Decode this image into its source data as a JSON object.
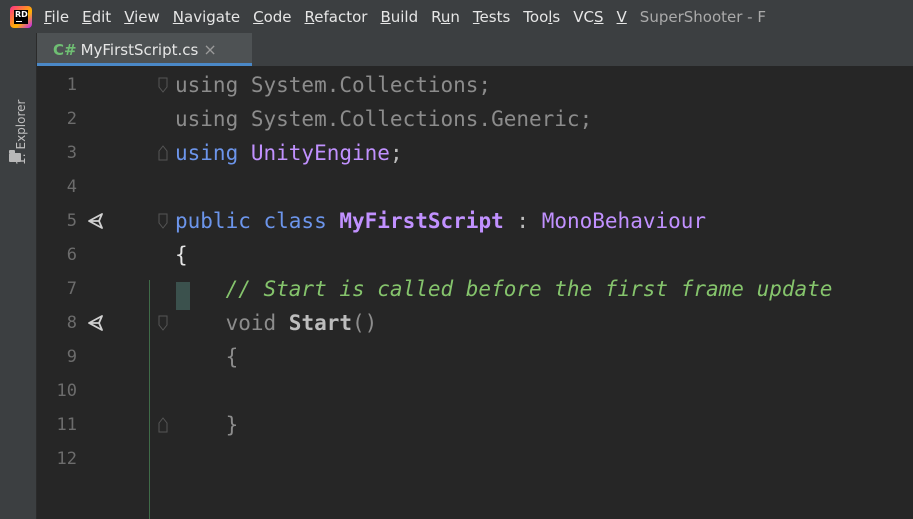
{
  "menubar": {
    "items": [
      {
        "label": "File",
        "mnemonic": "F",
        "rest": "ile"
      },
      {
        "label": "Edit",
        "mnemonic": "E",
        "rest": "dit"
      },
      {
        "label": "View",
        "mnemonic": "V",
        "rest": "iew"
      },
      {
        "label": "Navigate",
        "mnemonic": "N",
        "rest": "avigate"
      },
      {
        "label": "Code",
        "mnemonic": "C",
        "rest": "ode"
      },
      {
        "label": "Refactor",
        "mnemonic": "R",
        "rest": "efactor"
      },
      {
        "label": "Build",
        "mnemonic": "B",
        "rest": "uild"
      },
      {
        "label": "Run",
        "pre": "R",
        "mnemonic": "u",
        "rest": "n"
      },
      {
        "label": "Tests",
        "mnemonic": "T",
        "rest": "ests"
      },
      {
        "label": "Tools",
        "pre": "Too",
        "mnemonic": "l",
        "rest": "s"
      },
      {
        "label": "VCS",
        "pre": "VC",
        "mnemonic": "S",
        "rest": ""
      },
      {
        "label": "V",
        "mnemonic": "V",
        "rest": ""
      }
    ],
    "window_title": "SuperShooter - F"
  },
  "sidebar": {
    "explorer_label": "1: Explorer"
  },
  "tabs": [
    {
      "lang": "C#",
      "filename": "MyFirstScript.cs",
      "close": "×"
    }
  ],
  "editor": {
    "lines": [
      {
        "n": "1",
        "tokens": [
          [
            "dim",
            "using System.Collections;"
          ]
        ]
      },
      {
        "n": "2",
        "tokens": [
          [
            "dim",
            "using System.Collections.Generic;"
          ]
        ]
      },
      {
        "n": "3",
        "tokens": [
          [
            "kw",
            "using "
          ],
          [
            "ns",
            "UnityEngine"
          ],
          [
            "plain",
            ";"
          ]
        ]
      },
      {
        "n": "4",
        "tokens": []
      },
      {
        "n": "5",
        "tokens": [
          [
            "kw",
            "public class "
          ],
          [
            "classname",
            "MyFirstScript"
          ],
          [
            "plain",
            " : "
          ],
          [
            "type",
            "MonoBehaviour"
          ]
        ]
      },
      {
        "n": "6",
        "tokens": [
          [
            "brace",
            "{"
          ]
        ]
      },
      {
        "n": "7",
        "tokens": [
          [
            "comment",
            "    // Start is called before the first frame update"
          ]
        ]
      },
      {
        "n": "8",
        "tokens": [
          [
            "dim",
            "    void "
          ],
          [
            "method",
            "Start"
          ],
          [
            "dim",
            "()"
          ]
        ]
      },
      {
        "n": "9",
        "tokens": [
          [
            "dim",
            "    {"
          ]
        ]
      },
      {
        "n": "10",
        "tokens": []
      },
      {
        "n": "11",
        "tokens": [
          [
            "dim",
            "    }"
          ]
        ]
      },
      {
        "n": "12",
        "tokens": []
      }
    ]
  },
  "colors": {
    "menubar_bg": "#3c3f41",
    "editor_bg": "#262626",
    "keyword": "#6c95eb",
    "type": "#c191ff",
    "comment": "#85c46c",
    "tab_underline": "#4a88c7"
  }
}
